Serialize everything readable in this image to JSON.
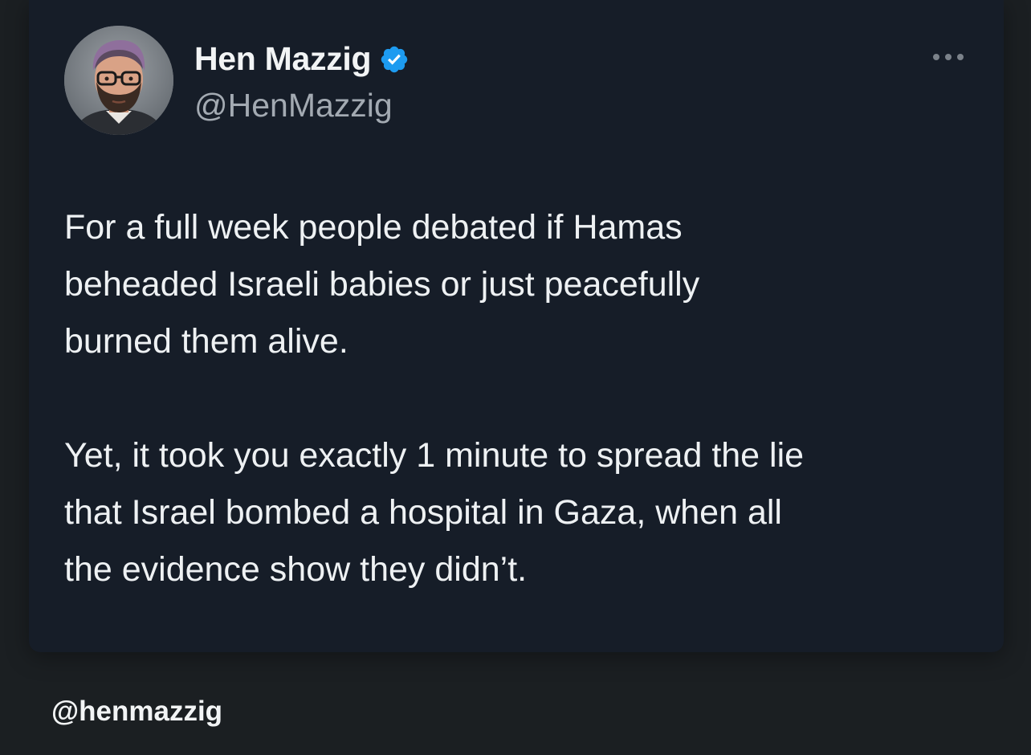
{
  "tweet": {
    "author": {
      "display_name": "Hen Mazzig",
      "handle": "@HenMazzig",
      "verified_icon": "verified-badge-icon",
      "avatar_icon": "avatar"
    },
    "more_icon": "more-options-icon",
    "body": {
      "paragraph_1": [
        "For a full week people debated if Hamas",
        "beheaded Israeli babies or just peacefully",
        "burned them alive."
      ],
      "paragraph_2": [
        "Yet, it took you exactly 1 minute to spread the lie",
        "that Israel bombed a hospital in Gaza, when all",
        "the evidence show they didn’t."
      ]
    }
  },
  "watermark": {
    "text": "@henmazzig"
  },
  "colors": {
    "background": "#1b1f22",
    "card": "#161d28",
    "text_primary": "#eef1f3",
    "text_secondary": "#a3aab2",
    "verified_blue": "#1d9bf0"
  }
}
